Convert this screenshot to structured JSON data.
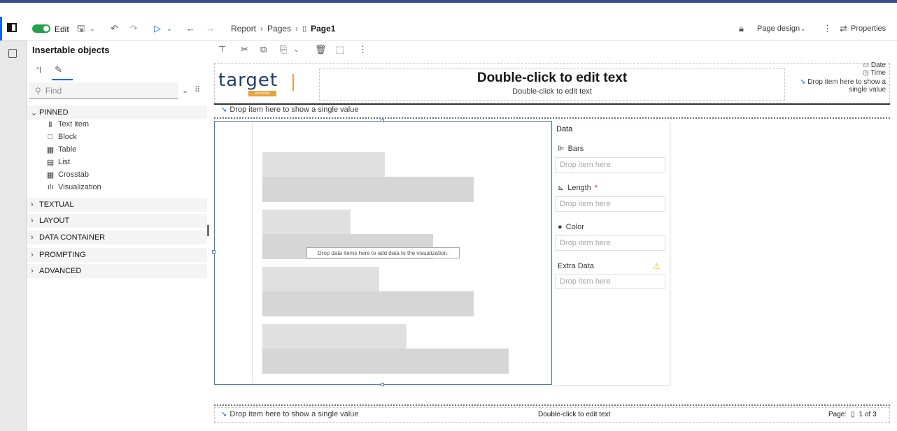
{
  "toolbar": {
    "edit_label": "Edit",
    "breadcrumb": [
      "Report",
      "Pages",
      "Page1"
    ],
    "page_design_label": "Page design",
    "properties_label": "Properties"
  },
  "insertable": {
    "title": "Insertable objects",
    "find_placeholder": "Find",
    "pinned_label": "PINNED",
    "pinned_items": [
      {
        "label": "Text item",
        "icon": "text-item-icon"
      },
      {
        "label": "Block",
        "icon": "block-icon"
      },
      {
        "label": "Table",
        "icon": "table-icon"
      },
      {
        "label": "List",
        "icon": "list-icon"
      },
      {
        "label": "Crosstab",
        "icon": "crosstab-icon"
      },
      {
        "label": "Visualization",
        "icon": "visualization-icon"
      }
    ],
    "sections": [
      "TEXTUAL",
      "LAYOUT",
      "DATA CONTAINER",
      "PROMPTING",
      "ADVANCED"
    ]
  },
  "header": {
    "logo_text": "target",
    "logo_sub": "services",
    "title": "Double-click to edit text",
    "subtitle": "Double-click to edit text",
    "date_label": "Date",
    "time_label": "Time",
    "drop_single_right": "Drop item here to show a single value",
    "drop_single_left": "Drop item here to show a single value"
  },
  "viz": {
    "hint": "Drop data items here to add data to the visualization."
  },
  "data_panel": {
    "title": "Data",
    "bars_label": "Bars",
    "length_label": "Length",
    "length_required": "*",
    "color_label": "Color",
    "extra_label": "Extra Data",
    "drop_text": "Drop item here"
  },
  "footer": {
    "drop_single": "Drop item here to show a single value",
    "center_text": "Double-click to edit text",
    "page_label": "Page:",
    "page_value": "1 of 3"
  },
  "colors": {
    "accent": "#0f62fe",
    "toggle": "#24a148",
    "selection": "#4a7ab8",
    "logo": "#1c3f6e",
    "logo_accent": "#e8a33b"
  }
}
